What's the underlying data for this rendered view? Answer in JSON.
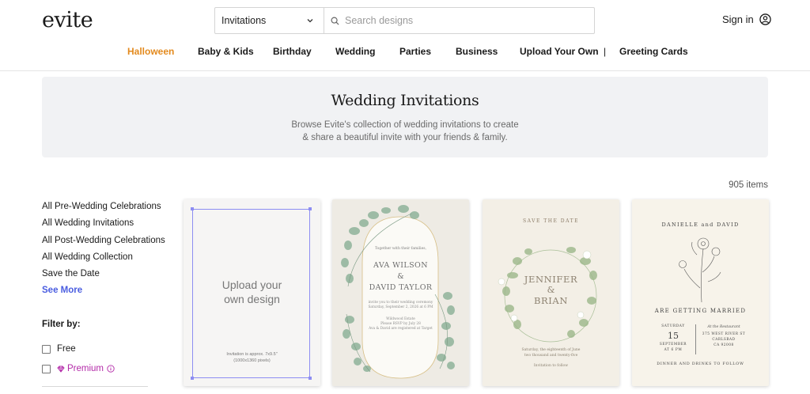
{
  "header": {
    "logo": "evite",
    "category_select": "Invitations",
    "search_placeholder": "Search designs",
    "signin": "Sign in"
  },
  "nav": [
    "Halloween",
    "Baby & Kids",
    "Birthday",
    "Wedding",
    "Parties",
    "Business",
    "Upload Your Own",
    "|",
    "Greeting Cards"
  ],
  "banner": {
    "title": "Wedding Invitations",
    "line1": "Browse Evite's collection of wedding invitations to create",
    "line2": "& share a beautiful invite with your friends & family."
  },
  "item_count": "905 items",
  "sidebar": {
    "links": [
      "All Pre-Wedding Celebrations",
      "All Wedding Invitations",
      "All Post-Wedding Celebrations",
      "All Wedding Collection",
      "Save the Date"
    ],
    "see_more": "See More",
    "filter_title": "Filter by:",
    "filters": [
      "Free",
      "Premium"
    ]
  },
  "cards": {
    "upload": {
      "line1": "Upload your",
      "line2": "own design",
      "note1": "Invitation is approx. 7x9.5\"",
      "note2": "(1000x1360 pixels)"
    },
    "ava": {
      "intro": "Together with their families,",
      "name1": "AVA WILSON",
      "amp": "&",
      "name2": "DAVID TAYLOR",
      "l1": "invite you to their wedding ceremony",
      "l2": "Saturday, September 2, 2026 at 6 PM",
      "l3": "Wildwood Estate",
      "l4": "Please RSVP by July 28",
      "l5": "Ava & David are registered at Target"
    },
    "jennifer": {
      "top": "SAVE THE DATE",
      "name1": "JENNIFER",
      "amp": "&",
      "name2": "BRIAN",
      "l1": "Saturday, the eighteenth of June",
      "l2": "two thousand and twenty-five",
      "l3": "Invitation to follow"
    },
    "danielle": {
      "names": "DANIELLE and DAVID",
      "headline": "ARE GETTING MARRIED",
      "day": "SATURDAY",
      "date": "15",
      "month": "SEPTEMBER",
      "time": "AT 6 PM",
      "venue1": "At the Restaurant",
      "venue2": "375 WEST RIVER ST",
      "venue3": "CARLSBAD",
      "venue4": "CA 92008",
      "footer": "DINNER AND DRINKS TO FOLLOW"
    }
  },
  "colors": {
    "accent_active": "#e38a1e",
    "link_blue": "#4a5de0",
    "premium_magenta": "#b32aa8"
  }
}
